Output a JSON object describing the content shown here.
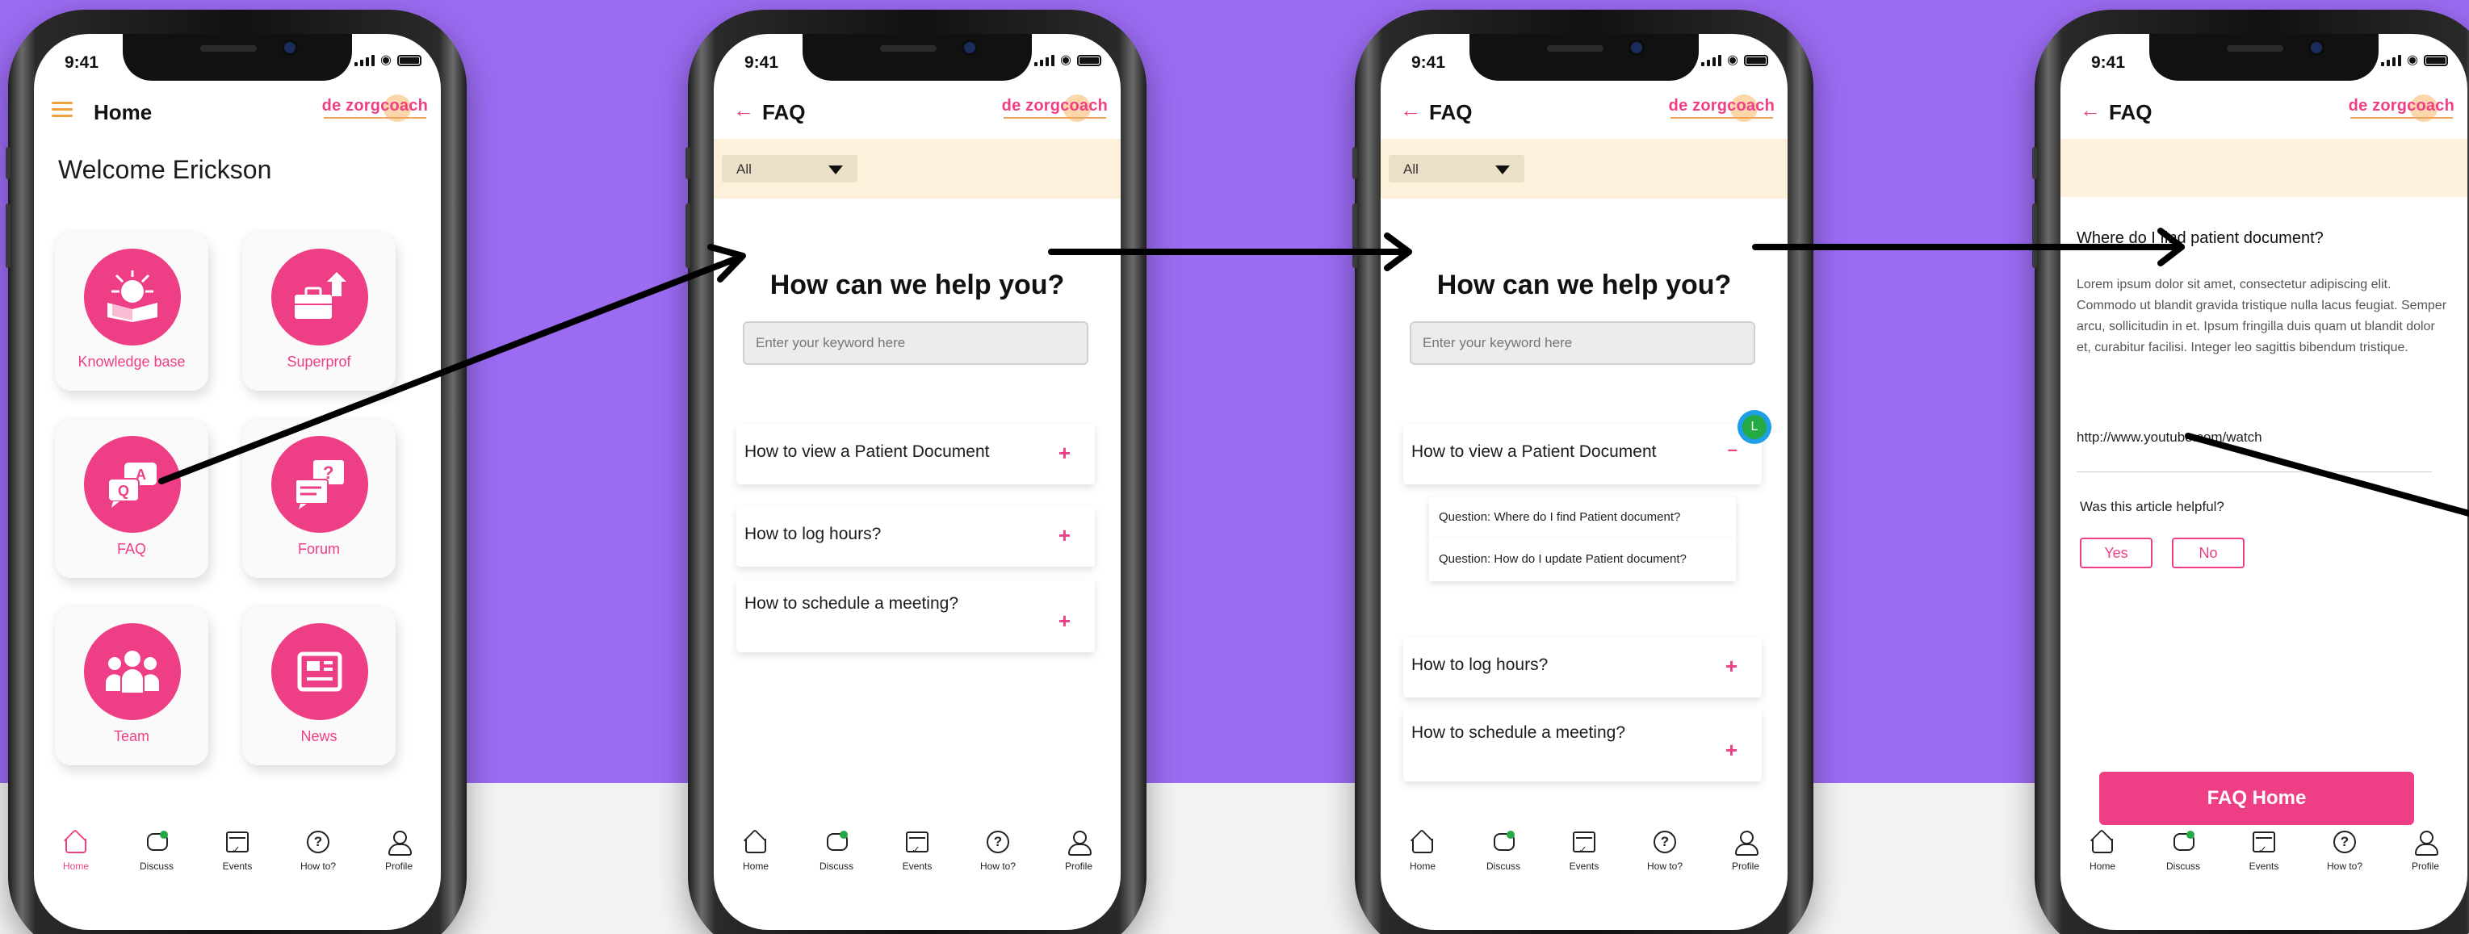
{
  "status_time": "9:41",
  "logo_text": "de zorgcoach",
  "colors": {
    "accent": "#ee3e85",
    "background_top": "#9b6bf2",
    "filter_bar": "#fdf1dc"
  },
  "screens": [
    {
      "appbar": {
        "title": "Home",
        "lead_icon": "hamburger-menu-icon"
      },
      "welcome": "Welcome Erickson",
      "tiles": [
        {
          "label": "Knowledge base",
          "icon": "book-icon"
        },
        {
          "label": "Superprof",
          "icon": "briefcase-icon"
        },
        {
          "label": "FAQ",
          "icon": "qa-bubbles-icon"
        },
        {
          "label": "Forum",
          "icon": "forum-icon"
        },
        {
          "label": "Team",
          "icon": "team-icon"
        },
        {
          "label": "News",
          "icon": "news-icon"
        }
      ]
    },
    {
      "appbar": {
        "title": "FAQ",
        "lead_icon": "back-arrow-icon"
      },
      "filter": "All",
      "help_title": "How can we help you?",
      "search_placeholder": "Enter your keyword here",
      "questions": [
        "How to view a Patient Document",
        "How to log hours?",
        "How to schedule a meeting?"
      ]
    },
    {
      "appbar": {
        "title": "FAQ",
        "lead_icon": "back-arrow-icon"
      },
      "filter": "All",
      "help_title": "How can we help you?",
      "search_placeholder": "Enter your keyword here",
      "questions": [
        "How to view a Patient Document",
        "How to log hours?",
        "How to schedule a meeting?"
      ],
      "expanded_items": [
        "Question: Where do I find Patient document?",
        "Question: How do I update Patient document?"
      ],
      "avatar_letter": "L"
    },
    {
      "appbar": {
        "title": "FAQ",
        "lead_icon": "back-arrow-icon"
      },
      "article_title": "Where do I find patient document?",
      "article_body": "Lorem ipsum dolor sit amet, consectetur adipiscing elit. Commodo ut blandit gravida tristique nulla lacus feugiat. Semper arcu, sollicitudin in et. Ipsum fringilla duis quam ut blandit dolor et, curabitur facilisi. Integer leo sagittis bibendum tristique.",
      "article_link": "http://www.youtube.com/watch",
      "helpful_question": "Was this article helpful?",
      "yes_label": "Yes",
      "no_label": "No",
      "faq_home_label": "FAQ Home"
    }
  ],
  "tabs": [
    "Home",
    "Discuss",
    "Events",
    "How to?",
    "Profile"
  ]
}
